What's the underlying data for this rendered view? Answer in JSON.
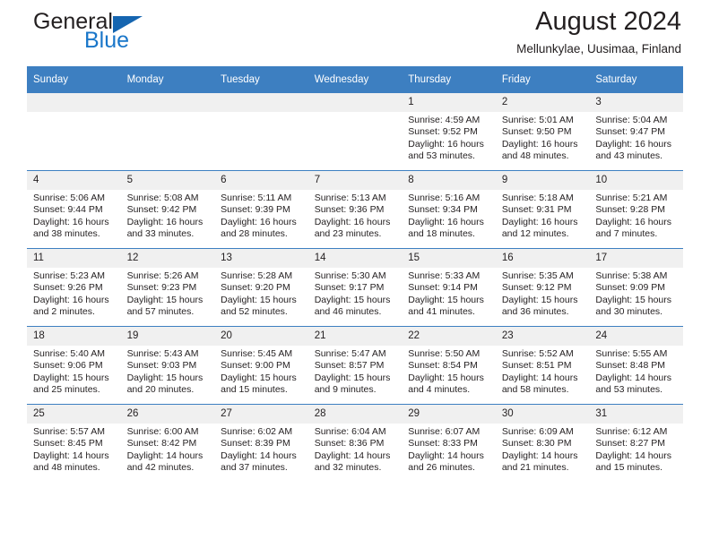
{
  "brand": {
    "name_primary": "General",
    "name_secondary": "Blue",
    "triangle_color": "#1565b0",
    "secondary_color": "#1976c9"
  },
  "header": {
    "title": "August 2024",
    "subtitle": "Mellunkylae, Uusimaa, Finland"
  },
  "theme": {
    "header_bar": "#3d7fc1",
    "daynum_bg": "#f0f0f0",
    "text": "#231f20"
  },
  "weekday_headers": [
    "Sunday",
    "Monday",
    "Tuesday",
    "Wednesday",
    "Thursday",
    "Friday",
    "Saturday"
  ],
  "labels": {
    "sunrise_prefix": "Sunrise: ",
    "sunset_prefix": "Sunset: ",
    "daylight_prefix": "Daylight: "
  },
  "weeks": [
    [
      {
        "day": "",
        "empty": true
      },
      {
        "day": "",
        "empty": true
      },
      {
        "day": "",
        "empty": true
      },
      {
        "day": "",
        "empty": true
      },
      {
        "day": "1",
        "sunrise": "Sunrise: 4:59 AM",
        "sunset": "Sunset: 9:52 PM",
        "daylight": "Daylight: 16 hours and 53 minutes."
      },
      {
        "day": "2",
        "sunrise": "Sunrise: 5:01 AM",
        "sunset": "Sunset: 9:50 PM",
        "daylight": "Daylight: 16 hours and 48 minutes."
      },
      {
        "day": "3",
        "sunrise": "Sunrise: 5:04 AM",
        "sunset": "Sunset: 9:47 PM",
        "daylight": "Daylight: 16 hours and 43 minutes."
      }
    ],
    [
      {
        "day": "4",
        "sunrise": "Sunrise: 5:06 AM",
        "sunset": "Sunset: 9:44 PM",
        "daylight": "Daylight: 16 hours and 38 minutes."
      },
      {
        "day": "5",
        "sunrise": "Sunrise: 5:08 AM",
        "sunset": "Sunset: 9:42 PM",
        "daylight": "Daylight: 16 hours and 33 minutes."
      },
      {
        "day": "6",
        "sunrise": "Sunrise: 5:11 AM",
        "sunset": "Sunset: 9:39 PM",
        "daylight": "Daylight: 16 hours and 28 minutes."
      },
      {
        "day": "7",
        "sunrise": "Sunrise: 5:13 AM",
        "sunset": "Sunset: 9:36 PM",
        "daylight": "Daylight: 16 hours and 23 minutes."
      },
      {
        "day": "8",
        "sunrise": "Sunrise: 5:16 AM",
        "sunset": "Sunset: 9:34 PM",
        "daylight": "Daylight: 16 hours and 18 minutes."
      },
      {
        "day": "9",
        "sunrise": "Sunrise: 5:18 AM",
        "sunset": "Sunset: 9:31 PM",
        "daylight": "Daylight: 16 hours and 12 minutes."
      },
      {
        "day": "10",
        "sunrise": "Sunrise: 5:21 AM",
        "sunset": "Sunset: 9:28 PM",
        "daylight": "Daylight: 16 hours and 7 minutes."
      }
    ],
    [
      {
        "day": "11",
        "sunrise": "Sunrise: 5:23 AM",
        "sunset": "Sunset: 9:26 PM",
        "daylight": "Daylight: 16 hours and 2 minutes."
      },
      {
        "day": "12",
        "sunrise": "Sunrise: 5:26 AM",
        "sunset": "Sunset: 9:23 PM",
        "daylight": "Daylight: 15 hours and 57 minutes."
      },
      {
        "day": "13",
        "sunrise": "Sunrise: 5:28 AM",
        "sunset": "Sunset: 9:20 PM",
        "daylight": "Daylight: 15 hours and 52 minutes."
      },
      {
        "day": "14",
        "sunrise": "Sunrise: 5:30 AM",
        "sunset": "Sunset: 9:17 PM",
        "daylight": "Daylight: 15 hours and 46 minutes."
      },
      {
        "day": "15",
        "sunrise": "Sunrise: 5:33 AM",
        "sunset": "Sunset: 9:14 PM",
        "daylight": "Daylight: 15 hours and 41 minutes."
      },
      {
        "day": "16",
        "sunrise": "Sunrise: 5:35 AM",
        "sunset": "Sunset: 9:12 PM",
        "daylight": "Daylight: 15 hours and 36 minutes."
      },
      {
        "day": "17",
        "sunrise": "Sunrise: 5:38 AM",
        "sunset": "Sunset: 9:09 PM",
        "daylight": "Daylight: 15 hours and 30 minutes."
      }
    ],
    [
      {
        "day": "18",
        "sunrise": "Sunrise: 5:40 AM",
        "sunset": "Sunset: 9:06 PM",
        "daylight": "Daylight: 15 hours and 25 minutes."
      },
      {
        "day": "19",
        "sunrise": "Sunrise: 5:43 AM",
        "sunset": "Sunset: 9:03 PM",
        "daylight": "Daylight: 15 hours and 20 minutes."
      },
      {
        "day": "20",
        "sunrise": "Sunrise: 5:45 AM",
        "sunset": "Sunset: 9:00 PM",
        "daylight": "Daylight: 15 hours and 15 minutes."
      },
      {
        "day": "21",
        "sunrise": "Sunrise: 5:47 AM",
        "sunset": "Sunset: 8:57 PM",
        "daylight": "Daylight: 15 hours and 9 minutes."
      },
      {
        "day": "22",
        "sunrise": "Sunrise: 5:50 AM",
        "sunset": "Sunset: 8:54 PM",
        "daylight": "Daylight: 15 hours and 4 minutes."
      },
      {
        "day": "23",
        "sunrise": "Sunrise: 5:52 AM",
        "sunset": "Sunset: 8:51 PM",
        "daylight": "Daylight: 14 hours and 58 minutes."
      },
      {
        "day": "24",
        "sunrise": "Sunrise: 5:55 AM",
        "sunset": "Sunset: 8:48 PM",
        "daylight": "Daylight: 14 hours and 53 minutes."
      }
    ],
    [
      {
        "day": "25",
        "sunrise": "Sunrise: 5:57 AM",
        "sunset": "Sunset: 8:45 PM",
        "daylight": "Daylight: 14 hours and 48 minutes."
      },
      {
        "day": "26",
        "sunrise": "Sunrise: 6:00 AM",
        "sunset": "Sunset: 8:42 PM",
        "daylight": "Daylight: 14 hours and 42 minutes."
      },
      {
        "day": "27",
        "sunrise": "Sunrise: 6:02 AM",
        "sunset": "Sunset: 8:39 PM",
        "daylight": "Daylight: 14 hours and 37 minutes."
      },
      {
        "day": "28",
        "sunrise": "Sunrise: 6:04 AM",
        "sunset": "Sunset: 8:36 PM",
        "daylight": "Daylight: 14 hours and 32 minutes."
      },
      {
        "day": "29",
        "sunrise": "Sunrise: 6:07 AM",
        "sunset": "Sunset: 8:33 PM",
        "daylight": "Daylight: 14 hours and 26 minutes."
      },
      {
        "day": "30",
        "sunrise": "Sunrise: 6:09 AM",
        "sunset": "Sunset: 8:30 PM",
        "daylight": "Daylight: 14 hours and 21 minutes."
      },
      {
        "day": "31",
        "sunrise": "Sunrise: 6:12 AM",
        "sunset": "Sunset: 8:27 PM",
        "daylight": "Daylight: 14 hours and 15 minutes."
      }
    ]
  ]
}
